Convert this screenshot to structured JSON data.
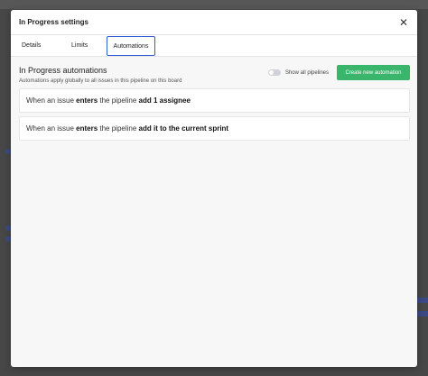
{
  "modal": {
    "title": "In Progress settings",
    "close_symbol": "✕"
  },
  "tabs": [
    {
      "label": "Details"
    },
    {
      "label": "Limits"
    },
    {
      "label": "Automations"
    }
  ],
  "automations": {
    "title": "In Progress automations",
    "subtitle": "Automations apply globally to all issues in this pipeline on this board",
    "show_all_label": "Show all pipelines",
    "show_all_enabled": false,
    "create_button_label": "Create new automation"
  },
  "rules": [
    {
      "prefix": "When an issue ",
      "event": "enters",
      "middle": " the pipeline ",
      "action": "add 1 assignee"
    },
    {
      "prefix": "When an issue ",
      "event": "enters",
      "middle": " the pipeline ",
      "action": "add it to the current sprint"
    }
  ],
  "colors": {
    "accent": "#2f5fd0",
    "create_button": "#3ab56c"
  }
}
